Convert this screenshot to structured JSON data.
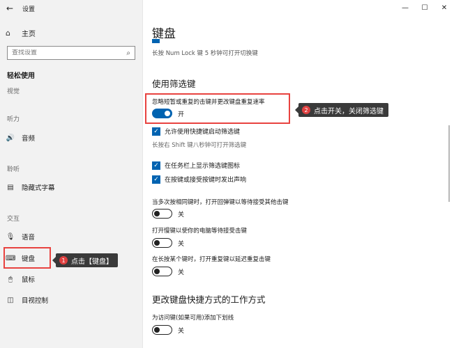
{
  "window": {
    "title": "设置",
    "back_icon": "←",
    "minimize_icon": "—",
    "maximize_icon": "☐",
    "close_icon": "✕"
  },
  "sidebar": {
    "home_label": "主页",
    "home_icon": "⌂",
    "search_placeholder": "查找设置",
    "search_icon": "⌕",
    "category_title": "轻松使用",
    "groups": {
      "vision": "视觉",
      "hearing": "听力",
      "hearing2": "聆听",
      "interaction": "交互"
    },
    "items": [
      {
        "label": "音频",
        "icon": "🔊"
      },
      {
        "label": "隐藏式字幕",
        "icon": "▤"
      },
      {
        "label": "语音",
        "icon": "🎙"
      },
      {
        "label": "键盘",
        "icon": "⌨"
      },
      {
        "label": "鼠标",
        "icon": "🖱"
      },
      {
        "label": "目视控制",
        "icon": "◫"
      }
    ]
  },
  "callouts": {
    "one": {
      "num": "1",
      "text": "点击【键盘】"
    },
    "two": {
      "num": "2",
      "text": "点击开关，关闭筛选键"
    }
  },
  "main": {
    "page_title": "键盘",
    "numlock_hint": "长按 Num Lock 键 5 秒钟可打开切换键",
    "filter_section_title": "使用筛选键",
    "filter_main_setting": "忽略短暂或重复的击键并更改键盘重复速率",
    "filter_toggle_state": "开",
    "filter_shortcut_check": "允许使用快捷键启动筛选键",
    "filter_shortcut_hint": "长按右 Shift 键八秒钟可打开筛选键",
    "taskbar_icon_check": "在任务栏上显示筛选键图标",
    "beep_check": "在按键或接受按键时发出声响",
    "bounce_setting": "当多次按相同键时，打开回弹键以等待接受其他击键",
    "bounce_state": "关",
    "slow_setting": "打开慢键以使你的电脑等待接受击键",
    "slow_state": "关",
    "repeat_setting": "在长按某个键时，打开重复键以延迟重复击键",
    "repeat_state": "关",
    "shortcut_section_title": "更改键盘快捷方式的工作方式",
    "underline_setting": "为访问键(如果可用)添加下划线",
    "underline_state": "关",
    "check_glyph": "✓"
  },
  "colors": {
    "accent": "#0063b1",
    "highlight": "#e8423f",
    "callout_bg": "#3a3a3a"
  }
}
